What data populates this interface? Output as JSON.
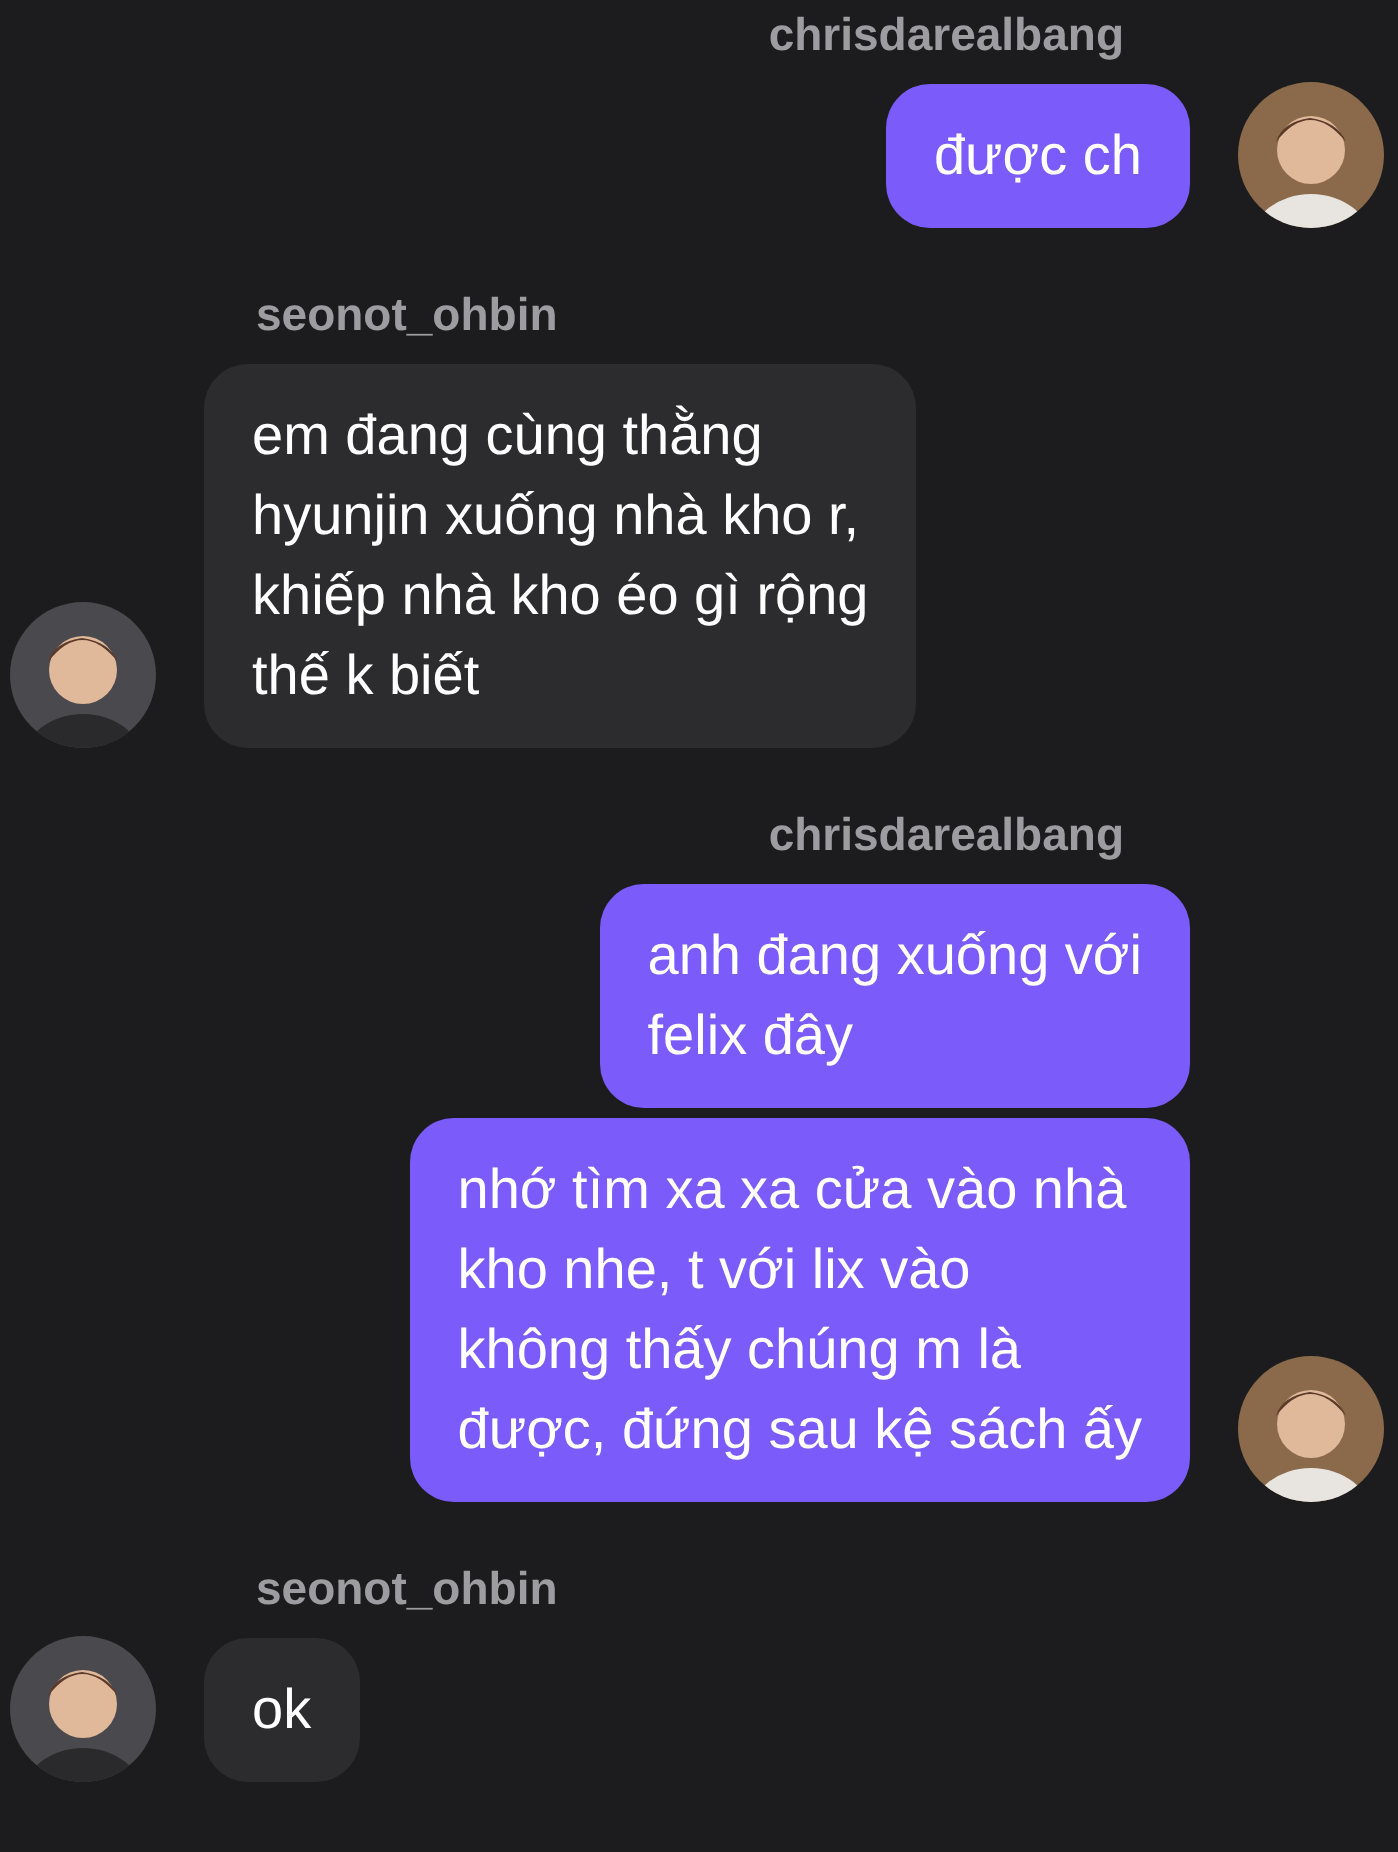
{
  "groups": [
    {
      "sender": "chrisdarealbang",
      "kind": "outgoing",
      "messages": [
        "được ch"
      ]
    },
    {
      "sender": "seonot_ohbin",
      "kind": "incoming",
      "messages": [
        "em đang cùng thằng\nhyunjin xuống nhà kho r,\nkhiếp nhà kho éo gì rộng\nthế k biết"
      ]
    },
    {
      "sender": "chrisdarealbang",
      "kind": "outgoing",
      "messages": [
        "anh đang xuống với\nfelix đây",
        "nhớ tìm xa xa cửa vào nhà\nkho nhe, t với lix vào\nkhông thấy chúng m là\nđược, đứng sau kệ sách ấy"
      ]
    },
    {
      "sender": "seonot_ohbin",
      "kind": "incoming",
      "messages": [
        "ok"
      ]
    }
  ]
}
